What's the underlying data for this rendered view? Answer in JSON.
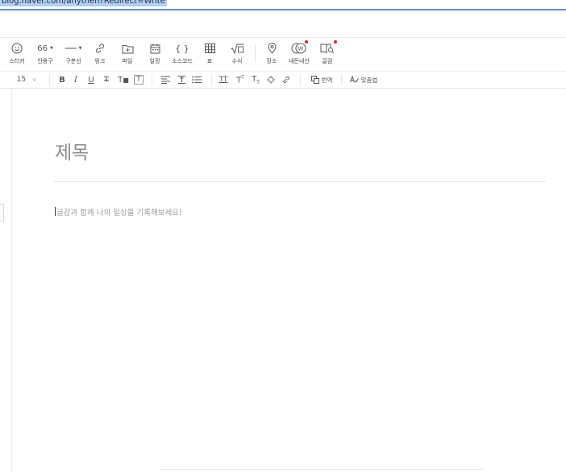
{
  "browser": {
    "url": "blog.naver.com/anythen?Redirect=Write"
  },
  "toolbar": {
    "items": [
      {
        "label": "스티커",
        "icon": "sticker-icon"
      },
      {
        "label": "인용구",
        "icon": "quote-icon",
        "glyph": "66"
      },
      {
        "label": "구분선",
        "icon": "divider-line-icon"
      },
      {
        "label": "링크",
        "icon": "link-icon"
      },
      {
        "label": "파일",
        "icon": "file-icon"
      },
      {
        "label": "일정",
        "icon": "calendar-icon"
      },
      {
        "label": "소스코드",
        "icon": "source-code-icon",
        "glyph": "{ }"
      },
      {
        "label": "표",
        "icon": "table-icon"
      },
      {
        "label": "수식",
        "icon": "formula-icon"
      },
      {
        "label": "장소",
        "icon": "place-pin-icon"
      },
      {
        "label": "내돈내산",
        "icon": "naedon-icon"
      },
      {
        "label": "글감",
        "icon": "material-book-icon"
      }
    ]
  },
  "format_bar": {
    "font_size": "15",
    "translate_label": "번역",
    "spellcheck_label": "맞춤법"
  },
  "editor": {
    "title_placeholder": "제목",
    "body_placeholder": "글감과 함께 나의 일상을 기록해보세요!"
  },
  "colors": {
    "accent": "#5b8dd6",
    "notify_dot": "#e0242e"
  }
}
